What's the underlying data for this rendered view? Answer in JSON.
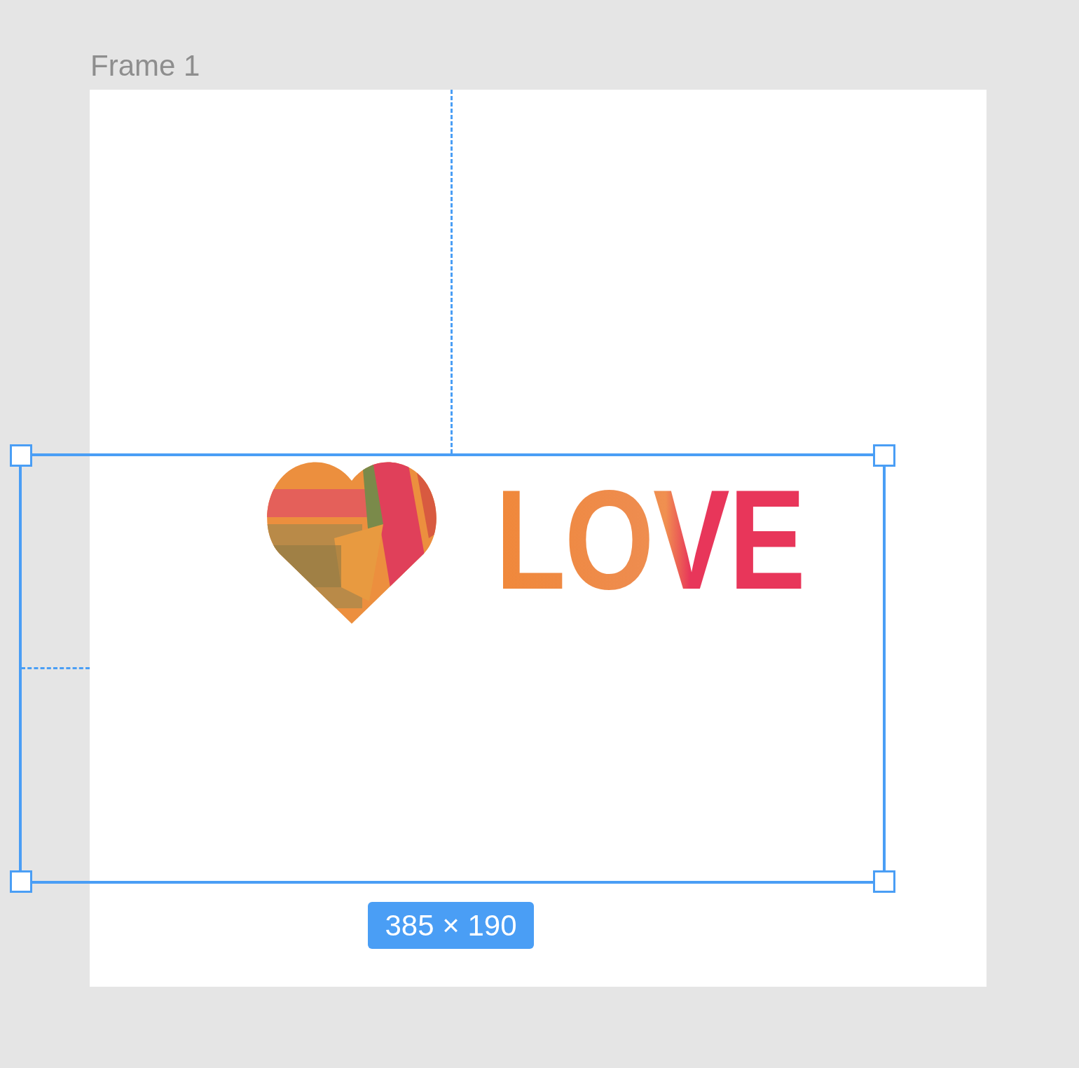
{
  "frame": {
    "title": "Frame 1"
  },
  "artwork": {
    "text": "LOVE"
  },
  "selection": {
    "size_label": "385 × 190"
  }
}
